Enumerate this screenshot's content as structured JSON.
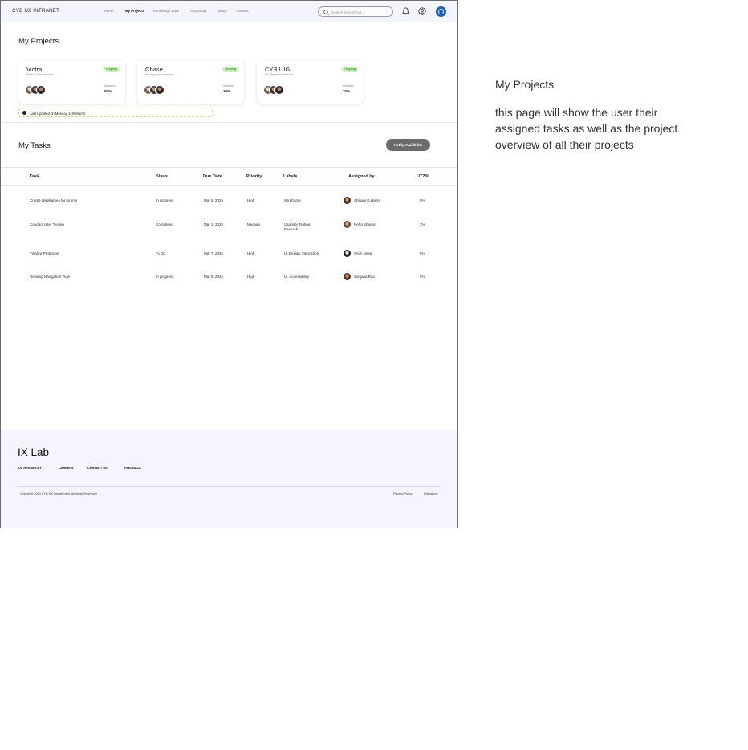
{
  "header": {
    "brand": "CYB UX INTRANET",
    "nav": [
      "Home",
      "My Projects",
      "Knowledge Base",
      "Repository",
      "Blogs",
      "Forums"
    ],
    "search_placeholder": "Search Something...",
    "icons": [
      "search-icon",
      "bell-icon",
      "user-circle-icon",
      "user-avatar"
    ]
  },
  "projects": {
    "title": "My Projects",
    "utilisation_label": "Utilisation",
    "cards": [
      {
        "name": "Victra",
        "subtitle": "Media & Entertainment",
        "status": "Ongoing",
        "util": "50%"
      },
      {
        "name": "Chase",
        "subtitle": "Banking and Investment",
        "status": "Ongoing",
        "util": "30%"
      },
      {
        "name": "CYB UIG",
        "subtitle": "UX Department Internal",
        "status": "Ongoing",
        "util": "20%"
      }
    ],
    "last_updated": "Last Updated on Monday 14th March"
  },
  "tasks": {
    "title": "My Tasks",
    "notify_button": "Notify Availibility",
    "columns": [
      "Task",
      "Staus",
      "Due Date",
      "Priority",
      "Labels",
      "Assigned by",
      "UTZ%"
    ],
    "rows": [
      {
        "task": "Create Wireframes for forums",
        "status": "In progress",
        "due": "Mar 5, 2025",
        "priority": "High",
        "labels": "Wireframe",
        "assigned_by": "Shibani Kulkarni",
        "utz": "8%"
      },
      {
        "task": "Conduct User Testing",
        "status": "Completed",
        "due": "Mar 1, 2025",
        "priority": "Medium",
        "labels": "Usability Testing, Feeback",
        "assigned_by": "Neha Sharma",
        "utz": "2%"
      },
      {
        "task": "Finalize Prototype",
        "status": "To Do",
        "due": "Mar 7, 2025",
        "priority": "High",
        "labels": "UI Design, Interaction",
        "assigned_by": "Arjun Desai",
        "utz": "5%"
      },
      {
        "task": "Revamp Navigation Flow",
        "status": "In progress",
        "due": "Mar 8, 2025",
        "priority": "High",
        "labels": "IA, Accessibility",
        "assigned_by": "Sanjana Rao",
        "utz": "5%"
      }
    ]
  },
  "footer": {
    "logo": "IX Lab",
    "links": [
      "UX HEIRARCHY",
      "CAREERS",
      "CONTACT US",
      "FEEDBACK"
    ],
    "copyright": "Copyright 2024 CYB UX Department, All rights Reserved",
    "legal": [
      "Privacy Policy",
      "Disclaimer"
    ]
  },
  "annotation": {
    "title": "My Projects",
    "body": "this page will show the user their assigned tasks as well as the project overview of all their projects"
  },
  "colors": {
    "header_bg": "#f4f4fd",
    "badge_bg": "#c9f3b8",
    "notify_bg": "#6b6b6b",
    "avatar_blue": "#1f5fb5"
  }
}
